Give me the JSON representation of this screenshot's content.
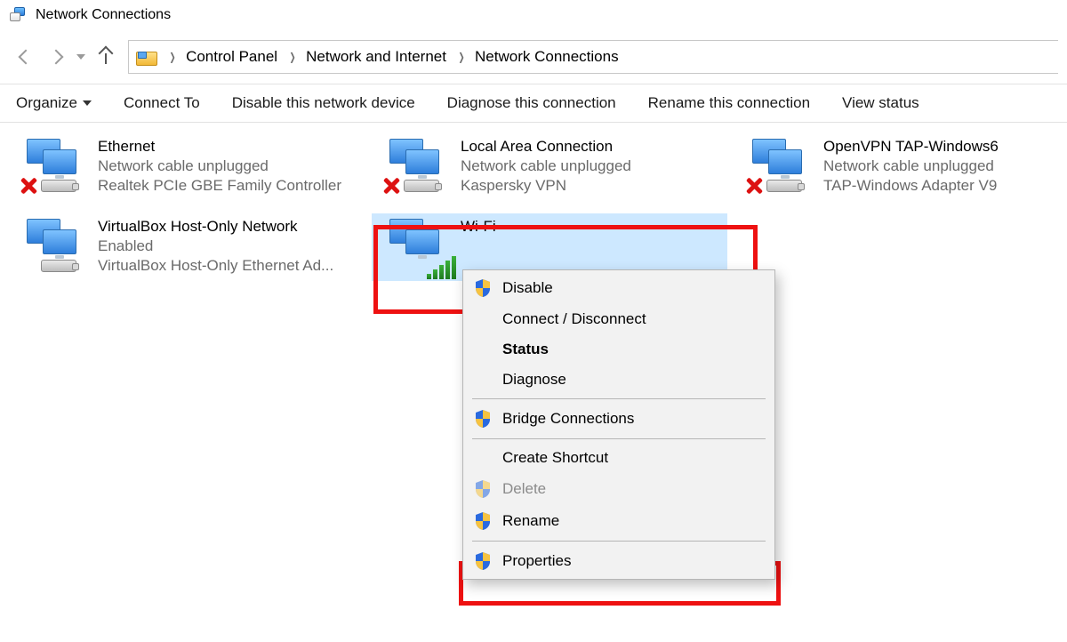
{
  "window": {
    "title": "Network Connections"
  },
  "breadcrumbs": {
    "root": "Control Panel",
    "mid": "Network and Internet",
    "leaf": "Network Connections"
  },
  "toolbar": {
    "organize": "Organize",
    "connect": "Connect To",
    "disable": "Disable this network device",
    "diagnose": "Diagnose this connection",
    "rename": "Rename this connection",
    "viewstatus": "View status"
  },
  "connections": [
    {
      "name": "Ethernet",
      "status": "Network cable unplugged",
      "device": "Realtek PCIe GBE Family Controller",
      "state": "unplugged"
    },
    {
      "name": "Local Area Connection",
      "status": "Network cable unplugged",
      "device": "Kaspersky VPN",
      "state": "unplugged"
    },
    {
      "name": "OpenVPN TAP-Windows6",
      "status": "Network cable unplugged",
      "device": "TAP-Windows Adapter V9",
      "state": "unplugged"
    },
    {
      "name": "VirtualBox Host-Only Network",
      "status": "Enabled",
      "device": "VirtualBox Host-Only Ethernet Ad...",
      "state": "enabled"
    },
    {
      "name": "Wi-Fi",
      "status": "",
      "device": "",
      "state": "wifi"
    }
  ],
  "context_menu": {
    "disable": "Disable",
    "connect": "Connect / Disconnect",
    "status": "Status",
    "diagnose": "Diagnose",
    "bridge": "Bridge Connections",
    "shortcut": "Create Shortcut",
    "delete": "Delete",
    "rename": "Rename",
    "properties": "Properties"
  }
}
